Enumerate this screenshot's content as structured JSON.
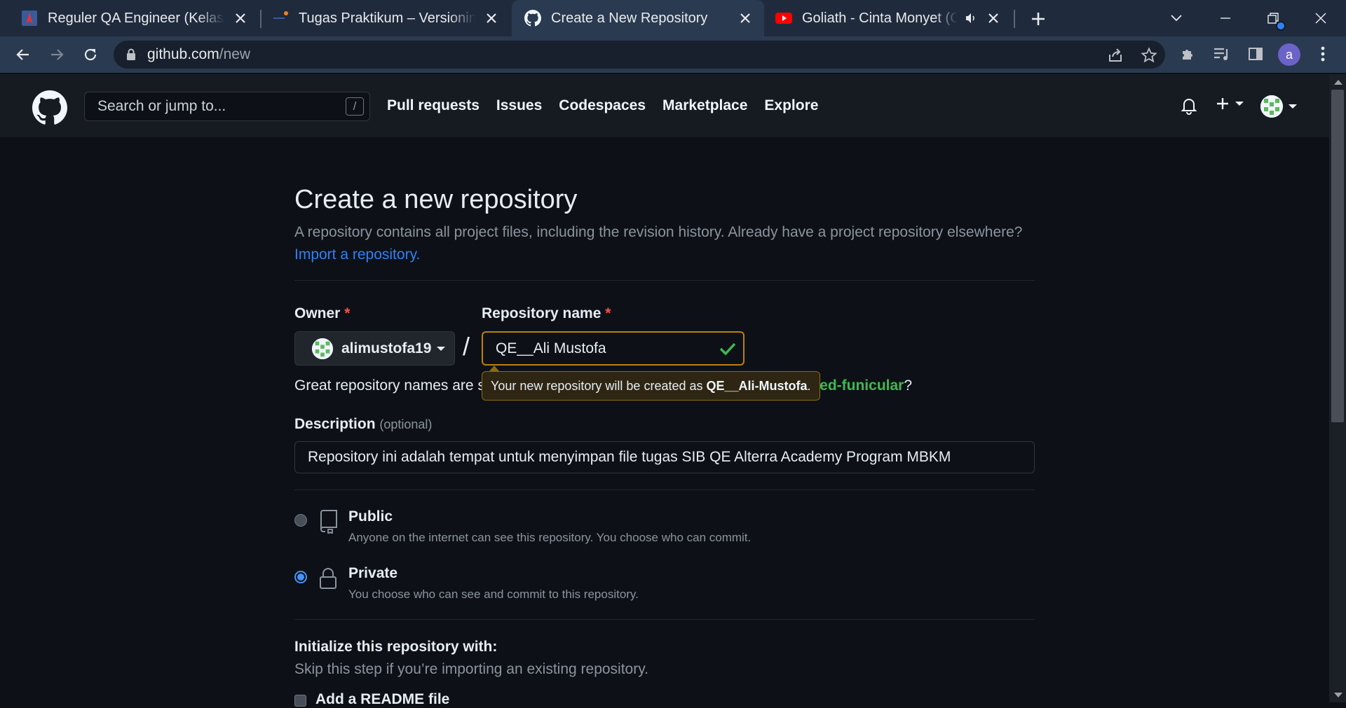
{
  "browser": {
    "tabs": [
      {
        "title": "Reguler QA Engineer (Kelas A, B, C",
        "favicon": "campus-icon",
        "active": false
      },
      {
        "title": "Tugas Praktikum – Versioning Co",
        "favicon": "document-dot-icon",
        "active": false
      },
      {
        "title": "Create a New Repository",
        "favicon": "github-icon",
        "active": true
      },
      {
        "title": "Goliath - Cinta Monyet (Offic",
        "favicon": "youtube-icon",
        "active": false,
        "audio": true
      }
    ],
    "url_host": "github.com",
    "url_path": "/new",
    "profile_initial": "a"
  },
  "github": {
    "search_placeholder": "Search or jump to...",
    "search_shortcut": "/",
    "nav": [
      "Pull requests",
      "Issues",
      "Codespaces",
      "Marketplace",
      "Explore"
    ]
  },
  "page": {
    "title": "Create a new repository",
    "subtitle": "A repository contains all project files, including the revision history. Already have a project repository elsewhere?",
    "import_link": "Import a repository.",
    "owner_label": "Owner",
    "required_mark": "*",
    "owner_value": "alimustofa19",
    "separator": "/",
    "repo_label": "Repository name",
    "repo_value": "QE__Ali Mustofa",
    "hint_prefix": "Great repository names are s",
    "hint_tail": "t ",
    "suggestion": "redesigned-funicular",
    "hint_suffix": "?",
    "tooltip_prefix": "Your new repository will be created as ",
    "tooltip_name": "QE__Ali-Mustofa",
    "tooltip_suffix": ".",
    "description_label": "Description",
    "description_optional": "(optional)",
    "description_value": "Repository ini adalah tempat untuk menyimpan file tugas SIB QE Alterra Academy Program MBKM",
    "visibility": [
      {
        "title": "Public",
        "desc": "Anyone on the internet can see this repository. You choose who can commit.",
        "selected": false
      },
      {
        "title": "Private",
        "desc": "You choose who can see and commit to this repository.",
        "selected": true
      }
    ],
    "init_title": "Initialize this repository with:",
    "init_subtitle": "Skip this step if you’re importing an existing repository.",
    "readme_label": "Add a README file"
  },
  "colors": {
    "accent_blue": "#2f81f7",
    "success_green": "#3fb950",
    "warning_border": "#bb8009",
    "required_red": "#f85149"
  }
}
